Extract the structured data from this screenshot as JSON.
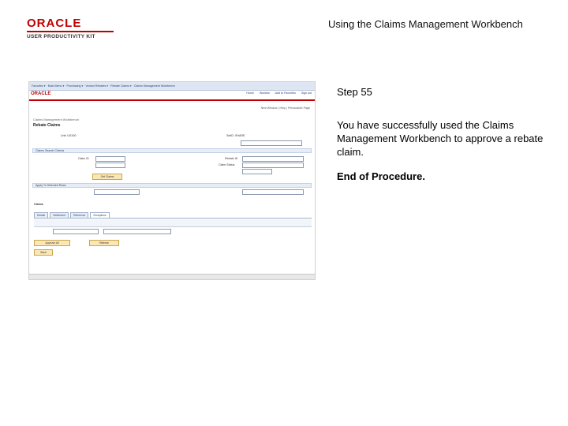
{
  "logo": {
    "brand": "ORACLE",
    "product": "USER PRODUCTIVITY KIT"
  },
  "header": {
    "title": "Using the Claims Management Workbench"
  },
  "step": {
    "title": "Step 55",
    "body": "You have successfully used the Claims Management Workbench to approve a rebate claim.",
    "end": "End of Procedure."
  },
  "screenshot": {
    "brand": "ORACLE",
    "section_title": "Rebate Claims",
    "page_title": "Claims Management Workbench",
    "nav_links": [
      "Home",
      "Worklist",
      "Add to Favorites",
      "Sign out"
    ],
    "labels": {
      "claim_id": "Claim ID",
      "rebate_id": "Rebate ID",
      "claim_status": "Claim Status",
      "claim_search_criteria": "Claims Search Criteria",
      "apply_to_selected_rows": "Apply To Selected Rows",
      "claims": "Claims"
    },
    "tabs": [
      "Details",
      "Settlement",
      "Reference",
      "Exceptions"
    ],
    "buttons": [
      "Get Claims",
      "Approve All",
      "Refresh",
      "Save"
    ]
  },
  "colors": {
    "oracle_red": "#c00000",
    "nav_blue": "#dfe6f3",
    "button_yellow": "#fbe7b6"
  }
}
